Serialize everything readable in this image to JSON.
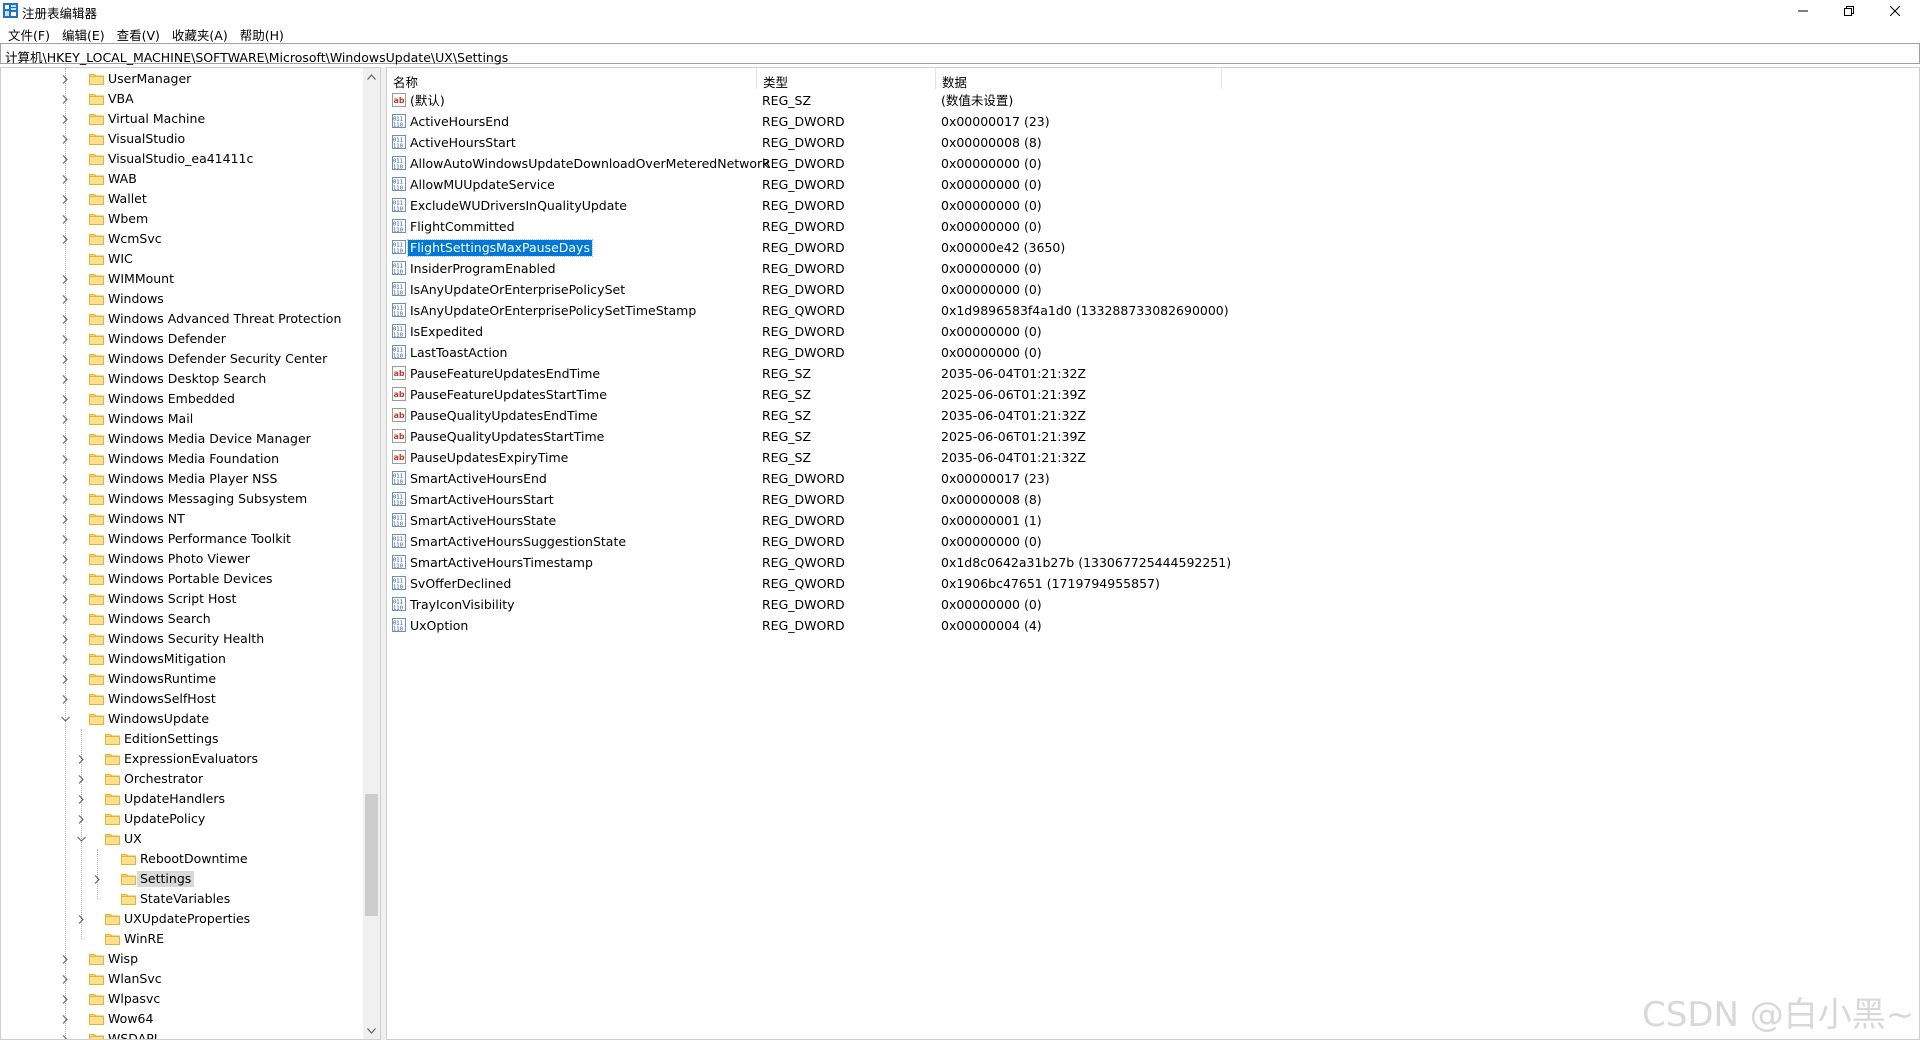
{
  "window": {
    "title": "注册表编辑器",
    "accent": "#0078d7"
  },
  "menu": [
    "文件(F)",
    "编辑(E)",
    "查看(V)",
    "收藏夹(A)",
    "帮助(H)"
  ],
  "address": "计算机\\HKEY_LOCAL_MACHINE\\SOFTWARE\\Microsoft\\WindowsUpdate\\UX\\Settings",
  "tree": [
    {
      "label": "UserManager",
      "level": 0,
      "expander": "collapsed"
    },
    {
      "label": "VBA",
      "level": 0,
      "expander": "collapsed"
    },
    {
      "label": "Virtual Machine",
      "level": 0,
      "expander": "collapsed"
    },
    {
      "label": "VisualStudio",
      "level": 0,
      "expander": "collapsed"
    },
    {
      "label": "VisualStudio_ea41411c",
      "level": 0,
      "expander": "collapsed"
    },
    {
      "label": "WAB",
      "level": 0,
      "expander": "collapsed"
    },
    {
      "label": "Wallet",
      "level": 0,
      "expander": "collapsed"
    },
    {
      "label": "Wbem",
      "level": 0,
      "expander": "collapsed"
    },
    {
      "label": "WcmSvc",
      "level": 0,
      "expander": "collapsed"
    },
    {
      "label": "WIC",
      "level": 0,
      "expander": "none"
    },
    {
      "label": "WIMMount",
      "level": 0,
      "expander": "collapsed"
    },
    {
      "label": "Windows",
      "level": 0,
      "expander": "collapsed"
    },
    {
      "label": "Windows Advanced Threat Protection",
      "level": 0,
      "expander": "collapsed"
    },
    {
      "label": "Windows Defender",
      "level": 0,
      "expander": "collapsed"
    },
    {
      "label": "Windows Defender Security Center",
      "level": 0,
      "expander": "collapsed"
    },
    {
      "label": "Windows Desktop Search",
      "level": 0,
      "expander": "collapsed"
    },
    {
      "label": "Windows Embedded",
      "level": 0,
      "expander": "collapsed"
    },
    {
      "label": "Windows Mail",
      "level": 0,
      "expander": "collapsed"
    },
    {
      "label": "Windows Media Device Manager",
      "level": 0,
      "expander": "collapsed"
    },
    {
      "label": "Windows Media Foundation",
      "level": 0,
      "expander": "collapsed"
    },
    {
      "label": "Windows Media Player NSS",
      "level": 0,
      "expander": "collapsed"
    },
    {
      "label": "Windows Messaging Subsystem",
      "level": 0,
      "expander": "collapsed"
    },
    {
      "label": "Windows NT",
      "level": 0,
      "expander": "collapsed"
    },
    {
      "label": "Windows Performance Toolkit",
      "level": 0,
      "expander": "collapsed"
    },
    {
      "label": "Windows Photo Viewer",
      "level": 0,
      "expander": "collapsed"
    },
    {
      "label": "Windows Portable Devices",
      "level": 0,
      "expander": "collapsed"
    },
    {
      "label": "Windows Script Host",
      "level": 0,
      "expander": "collapsed"
    },
    {
      "label": "Windows Search",
      "level": 0,
      "expander": "collapsed"
    },
    {
      "label": "Windows Security Health",
      "level": 0,
      "expander": "collapsed"
    },
    {
      "label": "WindowsMitigation",
      "level": 0,
      "expander": "collapsed"
    },
    {
      "label": "WindowsRuntime",
      "level": 0,
      "expander": "collapsed"
    },
    {
      "label": "WindowsSelfHost",
      "level": 0,
      "expander": "collapsed"
    },
    {
      "label": "WindowsUpdate",
      "level": 0,
      "expander": "expanded"
    },
    {
      "label": "EditionSettings",
      "level": 1,
      "expander": "none"
    },
    {
      "label": "ExpressionEvaluators",
      "level": 1,
      "expander": "collapsed"
    },
    {
      "label": "Orchestrator",
      "level": 1,
      "expander": "collapsed"
    },
    {
      "label": "UpdateHandlers",
      "level": 1,
      "expander": "collapsed"
    },
    {
      "label": "UpdatePolicy",
      "level": 1,
      "expander": "collapsed"
    },
    {
      "label": "UX",
      "level": 1,
      "expander": "expanded"
    },
    {
      "label": "RebootDowntime",
      "level": 2,
      "expander": "none"
    },
    {
      "label": "Settings",
      "level": 2,
      "expander": "collapsed",
      "selected": true
    },
    {
      "label": "StateVariables",
      "level": 2,
      "expander": "none"
    },
    {
      "label": "UXUpdateProperties",
      "level": 1,
      "expander": "collapsed"
    },
    {
      "label": "WinRE",
      "level": 1,
      "expander": "none"
    },
    {
      "label": "Wisp",
      "level": 0,
      "expander": "collapsed"
    },
    {
      "label": "WlanSvc",
      "level": 0,
      "expander": "collapsed"
    },
    {
      "label": "Wlpasvc",
      "level": 0,
      "expander": "collapsed"
    },
    {
      "label": "Wow64",
      "level": 0,
      "expander": "collapsed"
    },
    {
      "label": "WSDAPI",
      "level": 0,
      "expander": "collapsed"
    }
  ],
  "columns": {
    "name": "名称",
    "type": "类型",
    "data": "数据"
  },
  "values": [
    {
      "icon": "string-value-icon",
      "name": "(默认)",
      "type": "REG_SZ",
      "data": "(数值未设置)"
    },
    {
      "icon": "binary-value-icon",
      "name": "ActiveHoursEnd",
      "type": "REG_DWORD",
      "data": "0x00000017 (23)"
    },
    {
      "icon": "binary-value-icon",
      "name": "ActiveHoursStart",
      "type": "REG_DWORD",
      "data": "0x00000008 (8)"
    },
    {
      "icon": "binary-value-icon",
      "name": "AllowAutoWindowsUpdateDownloadOverMeteredNetwork",
      "type": "REG_DWORD",
      "data": "0x00000000 (0)"
    },
    {
      "icon": "binary-value-icon",
      "name": "AllowMUUpdateService",
      "type": "REG_DWORD",
      "data": "0x00000000 (0)"
    },
    {
      "icon": "binary-value-icon",
      "name": "ExcludeWUDriversInQualityUpdate",
      "type": "REG_DWORD",
      "data": "0x00000000 (0)"
    },
    {
      "icon": "binary-value-icon",
      "name": "FlightCommitted",
      "type": "REG_DWORD",
      "data": "0x00000000 (0)"
    },
    {
      "icon": "binary-value-icon",
      "name": "FlightSettingsMaxPauseDays",
      "type": "REG_DWORD",
      "data": "0x00000e42 (3650)",
      "selected": true
    },
    {
      "icon": "binary-value-icon",
      "name": "InsiderProgramEnabled",
      "type": "REG_DWORD",
      "data": "0x00000000 (0)"
    },
    {
      "icon": "binary-value-icon",
      "name": "IsAnyUpdateOrEnterprisePolicySet",
      "type": "REG_DWORD",
      "data": "0x00000000 (0)"
    },
    {
      "icon": "binary-value-icon",
      "name": "IsAnyUpdateOrEnterprisePolicySetTimeStamp",
      "type": "REG_QWORD",
      "data": "0x1d9896583f4a1d0 (133288733082690000)"
    },
    {
      "icon": "binary-value-icon",
      "name": "IsExpedited",
      "type": "REG_DWORD",
      "data": "0x00000000 (0)"
    },
    {
      "icon": "binary-value-icon",
      "name": "LastToastAction",
      "type": "REG_DWORD",
      "data": "0x00000000 (0)"
    },
    {
      "icon": "string-value-icon",
      "name": "PauseFeatureUpdatesEndTime",
      "type": "REG_SZ",
      "data": "2035-06-04T01:21:32Z"
    },
    {
      "icon": "string-value-icon",
      "name": "PauseFeatureUpdatesStartTime",
      "type": "REG_SZ",
      "data": "2025-06-06T01:21:39Z"
    },
    {
      "icon": "string-value-icon",
      "name": "PauseQualityUpdatesEndTime",
      "type": "REG_SZ",
      "data": "2035-06-04T01:21:32Z"
    },
    {
      "icon": "string-value-icon",
      "name": "PauseQualityUpdatesStartTime",
      "type": "REG_SZ",
      "data": "2025-06-06T01:21:39Z"
    },
    {
      "icon": "string-value-icon",
      "name": "PauseUpdatesExpiryTime",
      "type": "REG_SZ",
      "data": "2035-06-04T01:21:32Z"
    },
    {
      "icon": "binary-value-icon",
      "name": "SmartActiveHoursEnd",
      "type": "REG_DWORD",
      "data": "0x00000017 (23)"
    },
    {
      "icon": "binary-value-icon",
      "name": "SmartActiveHoursStart",
      "type": "REG_DWORD",
      "data": "0x00000008 (8)"
    },
    {
      "icon": "binary-value-icon",
      "name": "SmartActiveHoursState",
      "type": "REG_DWORD",
      "data": "0x00000001 (1)"
    },
    {
      "icon": "binary-value-icon",
      "name": "SmartActiveHoursSuggestionState",
      "type": "REG_DWORD",
      "data": "0x00000000 (0)"
    },
    {
      "icon": "binary-value-icon",
      "name": "SmartActiveHoursTimestamp",
      "type": "REG_QWORD",
      "data": "0x1d8c0642a31b27b (133067725444592251)"
    },
    {
      "icon": "binary-value-icon",
      "name": "SvOfferDeclined",
      "type": "REG_QWORD",
      "data": "0x1906bc47651 (1719794955857)"
    },
    {
      "icon": "binary-value-icon",
      "name": "TrayIconVisibility",
      "type": "REG_DWORD",
      "data": "0x00000000 (0)"
    },
    {
      "icon": "binary-value-icon",
      "name": "UxOption",
      "type": "REG_DWORD",
      "data": "0x00000004 (4)"
    }
  ],
  "watermark": "CSDN @白小黑~"
}
